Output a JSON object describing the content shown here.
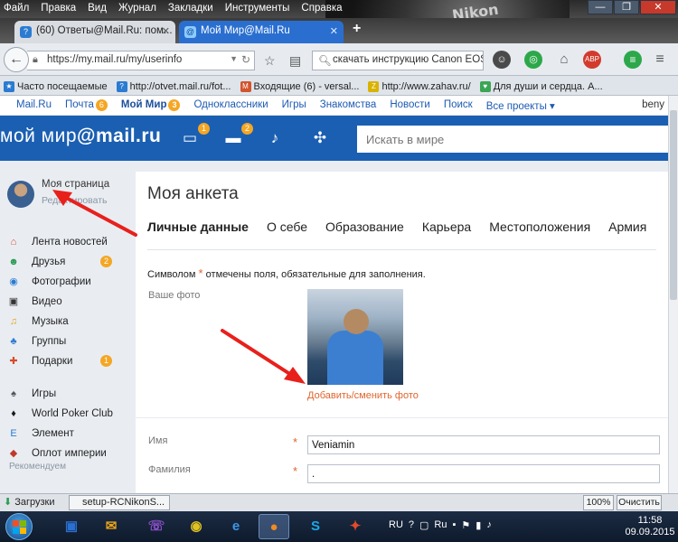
{
  "browser": {
    "menu": [
      "Файл",
      "Правка",
      "Вид",
      "Журнал",
      "Закладки",
      "Инструменты",
      "Справка"
    ],
    "photo_text": "Nikon",
    "window_buttons": [
      "—",
      "❐",
      "✕"
    ],
    "tabs": [
      {
        "title": "(60) Ответы@Mail.Ru: пом..."
      },
      {
        "title": "Мой Мир@Mail.Ru"
      }
    ],
    "new_tab": "+",
    "url": "https://my.mail.ru/my/userinfo",
    "search": "скачать инструкцию Canon EOS",
    "abp": "ABP",
    "bookmarks": [
      {
        "label": "Часто посещаемые",
        "color": "#2b7bd1",
        "glyph": "★"
      },
      {
        "label": "http://otvet.mail.ru/fot...",
        "color": "#2b7bd1",
        "glyph": "?"
      },
      {
        "label": "Входящие (6) - versal...",
        "color": "#d3542d",
        "glyph": "M"
      },
      {
        "label": "http://www.zahav.ru/",
        "color": "#d9b300",
        "glyph": "Z"
      },
      {
        "label": "Для души и сердца. А...",
        "color": "#3aa655",
        "glyph": "♥"
      }
    ]
  },
  "portal": {
    "items": [
      {
        "label": "Mail.Ru",
        "badge": ""
      },
      {
        "label": "Почта",
        "badge": "6"
      },
      {
        "label": "Мой Мир",
        "badge": "3"
      },
      {
        "label": "Одноклассники",
        "badge": ""
      },
      {
        "label": "Игры",
        "badge": ""
      },
      {
        "label": "Знакомства",
        "badge": ""
      },
      {
        "label": "Новости",
        "badge": ""
      },
      {
        "label": "Поиск",
        "badge": ""
      },
      {
        "label": "Все проекты ▾",
        "badge": ""
      }
    ],
    "user": "beny"
  },
  "header": {
    "logo_main": "мой мир",
    "logo_domain": "@mail.ru",
    "messages_badge": "1",
    "chat_badge": "2",
    "search_placeholder": "Искать в мире"
  },
  "sidebar": {
    "my_page": "Моя страница",
    "edit": "Редактировать",
    "items": [
      {
        "label": "Лента новостей",
        "badge": "",
        "glyph": "⌂",
        "color": "#d84b2a"
      },
      {
        "label": "Друзья",
        "badge": "2",
        "glyph": "☻",
        "color": "#2a9c54"
      },
      {
        "label": "Фотографии",
        "badge": "",
        "glyph": "◉",
        "color": "#2b7bd1"
      },
      {
        "label": "Видео",
        "badge": "",
        "glyph": "▣",
        "color": "#333"
      },
      {
        "label": "Музыка",
        "badge": "",
        "glyph": "♫",
        "color": "#e8a21a"
      },
      {
        "label": "Группы",
        "badge": "",
        "glyph": "♣",
        "color": "#2b7bd1"
      },
      {
        "label": "Подарки",
        "badge": "1",
        "glyph": "✚",
        "color": "#d84b2a"
      },
      {
        "label": "Игры",
        "badge": "",
        "glyph": "♠",
        "color": "#555"
      },
      {
        "label": "World Poker Club",
        "badge": "",
        "glyph": "♦",
        "color": "#1a1a1a"
      },
      {
        "label": "Элемент",
        "badge": "",
        "glyph": "E",
        "color": "#2b7bd1"
      },
      {
        "label": "Оплот империи",
        "badge": "",
        "glyph": "◆",
        "color": "#c0392b"
      }
    ],
    "recommended": "Рекомендуем"
  },
  "form": {
    "title": "Моя анкета",
    "tabs": [
      "Личные данные",
      "О себе",
      "Образование",
      "Карьера",
      "Местоположения",
      "Армия"
    ],
    "required_note_before": "Символом",
    "required_star": "*",
    "required_note_after": "отмечены поля, обязательные для заполнения.",
    "photo_label": "Ваше фото",
    "change_photo": "Добавить/сменить фото",
    "name_label": "Имя",
    "name_value": "Veniamin",
    "surname_label": "Фамилия",
    "surname_value": "."
  },
  "downloads": {
    "label": "Загрузки",
    "file": "setup-RCNikonS...",
    "zoom": "100%",
    "clear": "Очистить"
  },
  "taskbar": {
    "lang": "RU",
    "tray_lang": "Ru",
    "time": "11:58",
    "date": "09.09.2015"
  },
  "colors": {
    "brand_blue": "#1b5fb2",
    "accent_orange": "#e0642d",
    "badge_orange": "#f5a623",
    "arrow_red": "#e8201c"
  }
}
